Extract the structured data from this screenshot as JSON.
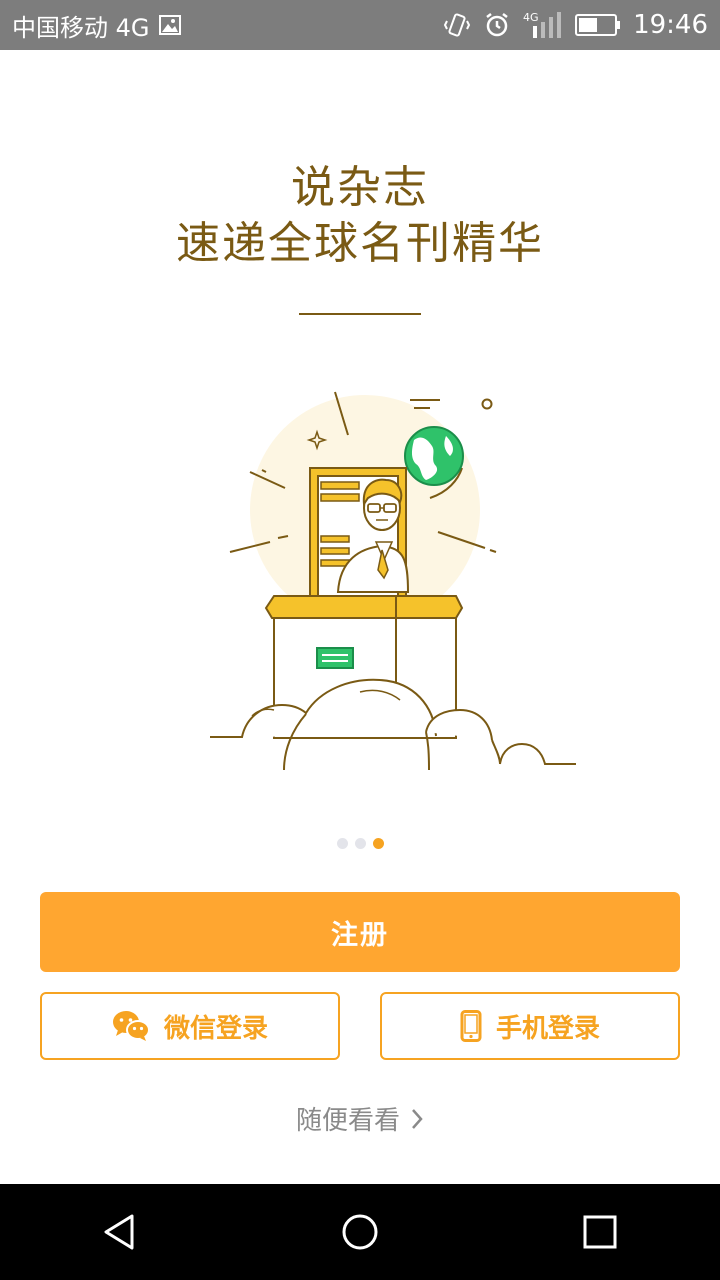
{
  "status_bar": {
    "carrier": "中国移动 4G",
    "network_small": "4G",
    "time": "19:46",
    "icons": [
      "image-icon",
      "vibrate-icon",
      "alarm-icon",
      "signal-icon",
      "battery-icon"
    ]
  },
  "hero": {
    "line1": "说杂志",
    "line2": "速递全球名刊精华"
  },
  "pager": {
    "count": 3,
    "active_index": 2
  },
  "actions": {
    "register_label": "注册",
    "wechat_label": "微信登录",
    "phone_label": "手机登录",
    "browse_label": "随便看看"
  },
  "colors": {
    "accent": "#ffa630",
    "outline": "#f6a321",
    "headline": "#7a5a14",
    "globe": "#2fc26a",
    "pillar": "#f5c22b"
  },
  "nav": {
    "icons": [
      "back-icon",
      "home-icon",
      "recents-icon"
    ]
  }
}
